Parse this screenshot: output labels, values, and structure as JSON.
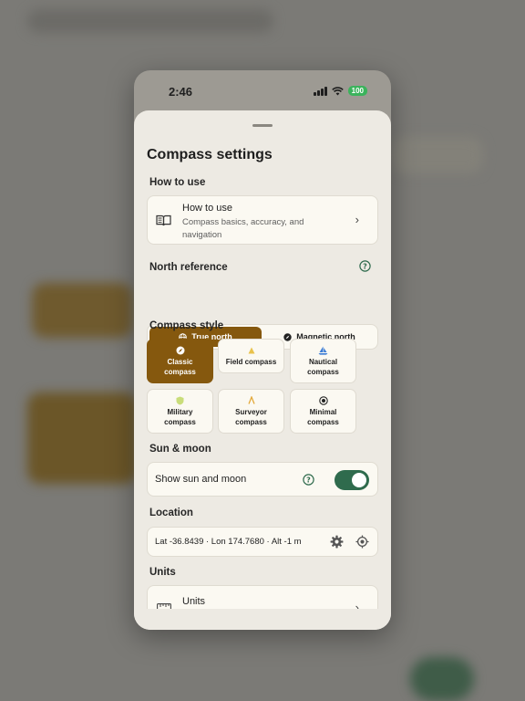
{
  "status_bar": {
    "time": "2:46",
    "battery": "100"
  },
  "sheet": {
    "title": "Compass settings",
    "how_to_use": {
      "section_label": "How to use",
      "row_title": "How to use",
      "row_subtitle": "Compass basics, accuracy, and navigation",
      "icon": "book-icon"
    },
    "north_reference": {
      "section_label": "North reference",
      "options": [
        {
          "label": "True north",
          "icon": "globe-icon",
          "selected": true
        },
        {
          "label": "Magnetic north",
          "icon": "compass-icon",
          "selected": false
        }
      ]
    },
    "compass_style": {
      "section_label": "Compass style",
      "tiles": [
        {
          "line1": "Classic",
          "line2": "compass",
          "icon": "compass-icon",
          "selected": true
        },
        {
          "line1": "Field compass",
          "line2": "",
          "icon": "triangle-icon",
          "selected": false
        },
        {
          "line1": "Nautical",
          "line2": "compass",
          "icon": "sailboat-icon",
          "selected": false
        },
        {
          "line1": "Military",
          "line2": "compass",
          "icon": "shield-icon",
          "selected": false
        },
        {
          "line1": "Surveyor",
          "line2": "compass",
          "icon": "caret-icon",
          "selected": false
        },
        {
          "line1": "Minimal",
          "line2": "compass",
          "icon": "target-icon",
          "selected": false
        }
      ]
    },
    "sun_moon": {
      "section_label": "Sun & moon",
      "toggle_label": "Show sun and moon",
      "toggle_on": true
    },
    "location": {
      "section_label": "Location",
      "readout": "Lat -36.8439 · Lon 174.7680 · Alt -1 m"
    },
    "units": {
      "section_label": "Units",
      "row_title": "Units"
    }
  },
  "colors": {
    "accent_brown": "#85580e",
    "toggle_green": "#2f6b4d",
    "help_green": "#2f6b4d",
    "sheet_bg": "#edeae3",
    "card_bg": "#fbf9f2"
  }
}
